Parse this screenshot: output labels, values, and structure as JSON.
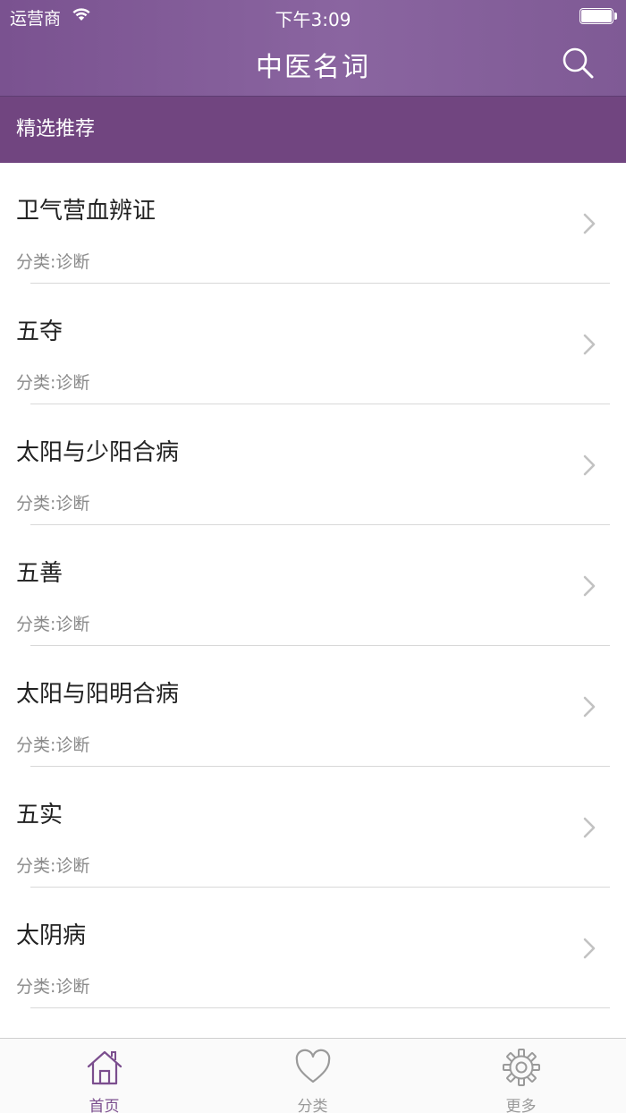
{
  "status_bar": {
    "carrier": "运营商",
    "time": "下午3:09"
  },
  "nav": {
    "title": "中医名词",
    "search_icon": "search-icon"
  },
  "section": {
    "title": "精选推荐"
  },
  "items": [
    {
      "title": "卫气营血辨证",
      "category": "分类:诊断"
    },
    {
      "title": "五夺",
      "category": "分类:诊断"
    },
    {
      "title": "太阳与少阳合病",
      "category": "分类:诊断"
    },
    {
      "title": "五善",
      "category": "分类:诊断"
    },
    {
      "title": "太阳与阳明合病",
      "category": "分类:诊断"
    },
    {
      "title": "五实",
      "category": "分类:诊断"
    },
    {
      "title": "太阴病",
      "category": "分类:诊断"
    }
  ],
  "tabs": [
    {
      "label": "首页",
      "icon": "home-icon",
      "active": true
    },
    {
      "label": "分类",
      "icon": "heart-icon",
      "active": false
    },
    {
      "label": "更多",
      "icon": "gear-icon",
      "active": false
    }
  ],
  "colors": {
    "nav_bg": "#7a5290",
    "section_bg": "#714580",
    "accent": "#7b4e8e"
  }
}
